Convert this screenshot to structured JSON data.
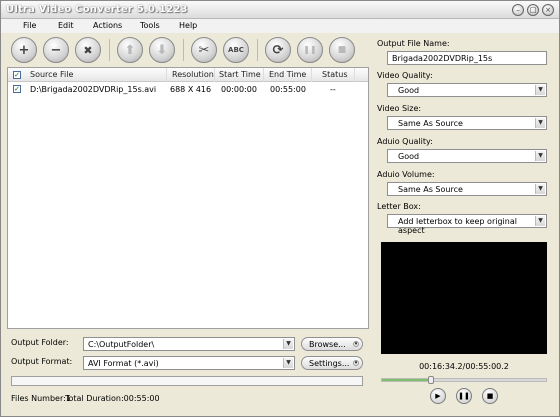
{
  "window": {
    "title": "Ultra Video Converter 5.0.1223"
  },
  "menu": [
    "File",
    "Edit",
    "Actions",
    "Tools",
    "Help"
  ],
  "toolbar": {
    "add": "+",
    "remove": "−",
    "clear": "✖",
    "up": "⬆",
    "down": "⬇",
    "cut": "✂",
    "rename": "ABC",
    "convert": "⟳",
    "pause": "❚❚",
    "stop": "■"
  },
  "list": {
    "headers": [
      "Source File",
      "Resolution",
      "Start Time",
      "End Time",
      "Status"
    ],
    "rows": [
      {
        "checked": true,
        "source": "D:\\Brigada2002DVDRip_15s.avi",
        "resolution": "688 X 416",
        "start": "00:00:00",
        "end": "00:55:00",
        "status": "--"
      }
    ]
  },
  "output": {
    "folder_label": "Output Folder:",
    "folder_value": "C:\\OutputFolder\\",
    "browse_label": "Browse...",
    "format_label": "Output Format:",
    "format_value": "AVI Format (*.avi)",
    "settings_label": "Settings..."
  },
  "status": {
    "files": "Files Number:1",
    "duration": "Total Duration:00:55:00"
  },
  "settings": {
    "output_file_name_label": "Output File Name:",
    "output_file_name_value": "Brigada2002DVDRip_15s",
    "video_quality_label": "Video Quality:",
    "video_quality_value": "Good",
    "video_size_label": "Video Size:",
    "video_size_value": "Same As Source",
    "audio_quality_label": "Aduio Quality:",
    "audio_quality_value": "Good",
    "audio_volume_label": "Aduio Volume:",
    "audio_volume_value": "Same As Source",
    "letter_box_label": "Letter Box:",
    "letter_box_value": "Add letterbox to keep original aspect"
  },
  "player": {
    "time": "00:16:34.2/00:55:00.2",
    "progress_fraction": 0.3
  },
  "colors": {
    "preview_bg": "#000000",
    "seek_fill": "#7fbf6b"
  }
}
